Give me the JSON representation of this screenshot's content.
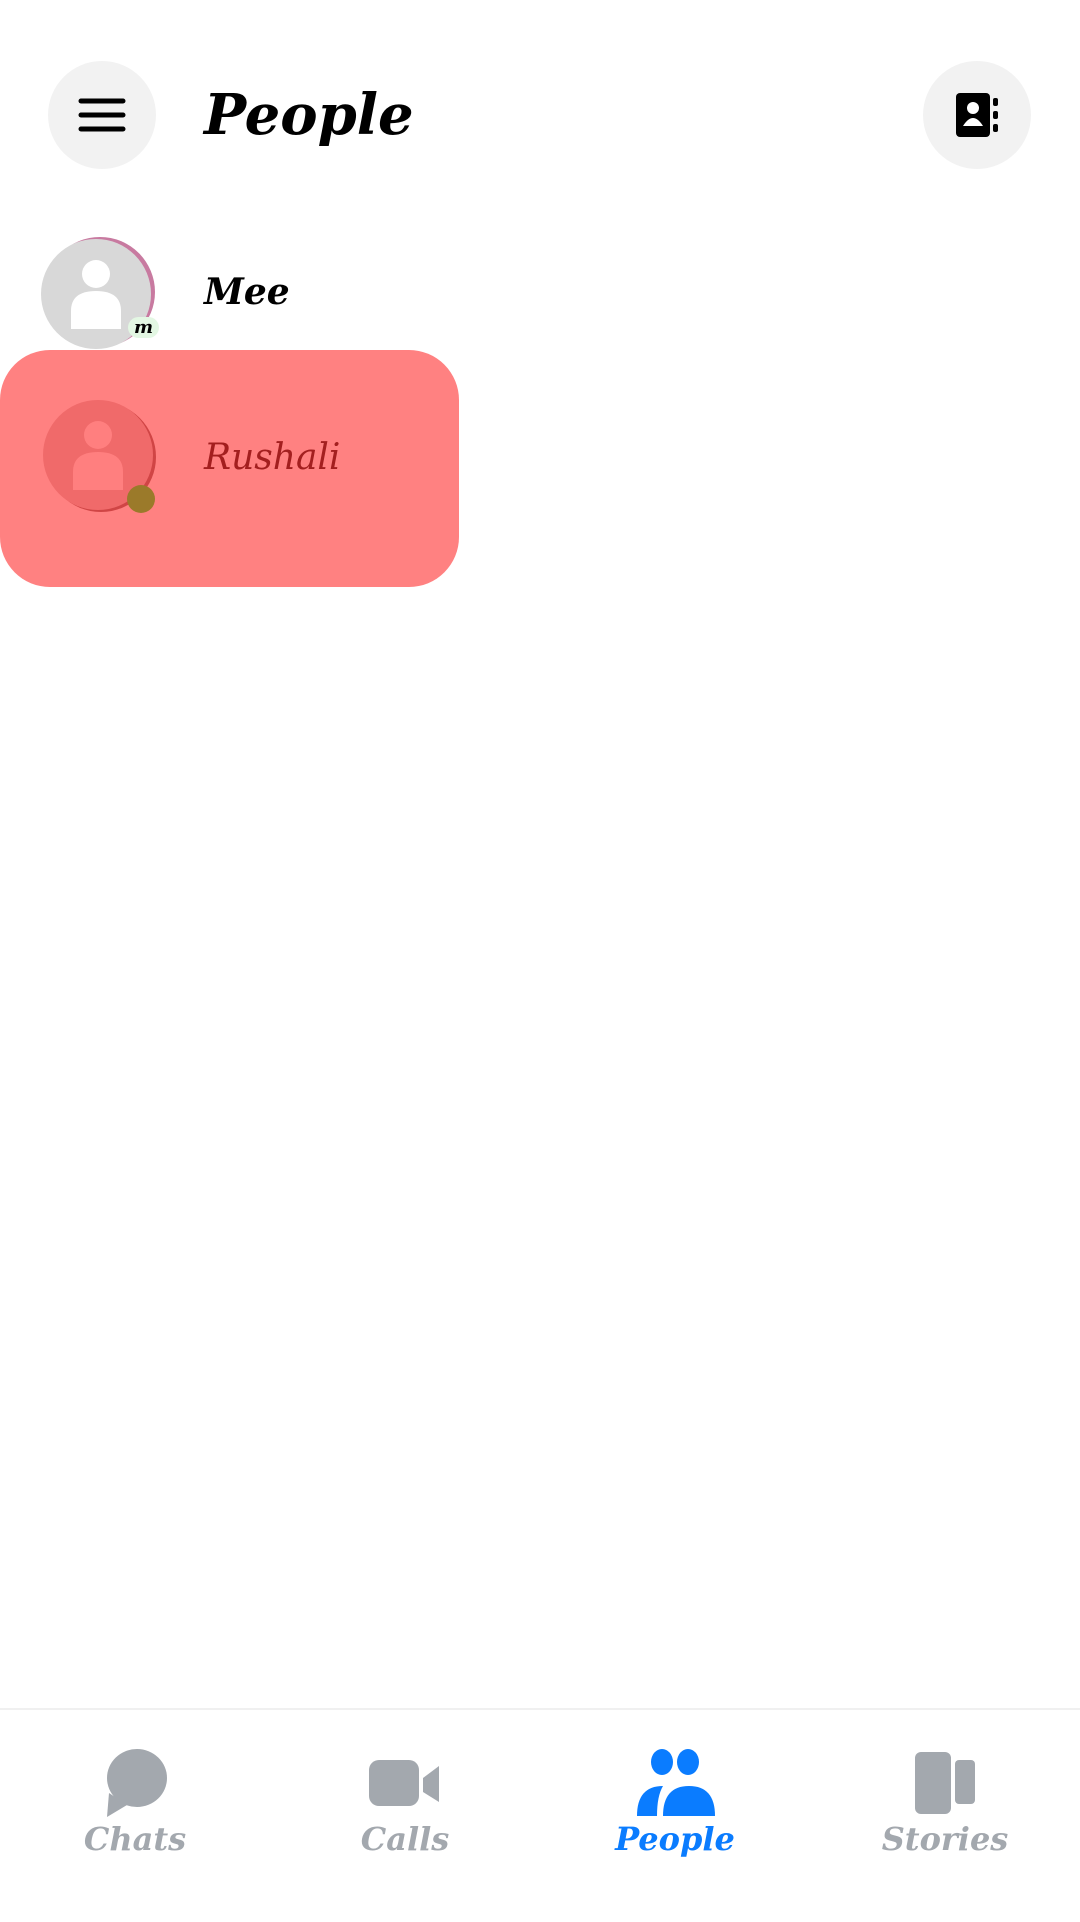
{
  "header": {
    "title": "People",
    "menu_icon": "hamburger-icon",
    "contacts_icon": "contact-book-icon"
  },
  "people": [
    {
      "name": "Mee",
      "status_badge": "m",
      "badge_color": "#e3f7e3"
    },
    {
      "name": "Rushali",
      "online": true,
      "online_color": "#9b7a2a",
      "highlighted": true,
      "highlight_color": "#ff7b7b"
    }
  ],
  "nav": {
    "tabs": [
      {
        "label": "Chats",
        "icon": "chat-bubble-icon",
        "active": false
      },
      {
        "label": "Calls",
        "icon": "video-camera-icon",
        "active": false
      },
      {
        "label": "People",
        "icon": "people-icon",
        "active": true
      },
      {
        "label": "Stories",
        "icon": "stories-icon",
        "active": false
      }
    ],
    "active_color": "#0a7cff",
    "inactive_color": "#a3a8ae"
  }
}
